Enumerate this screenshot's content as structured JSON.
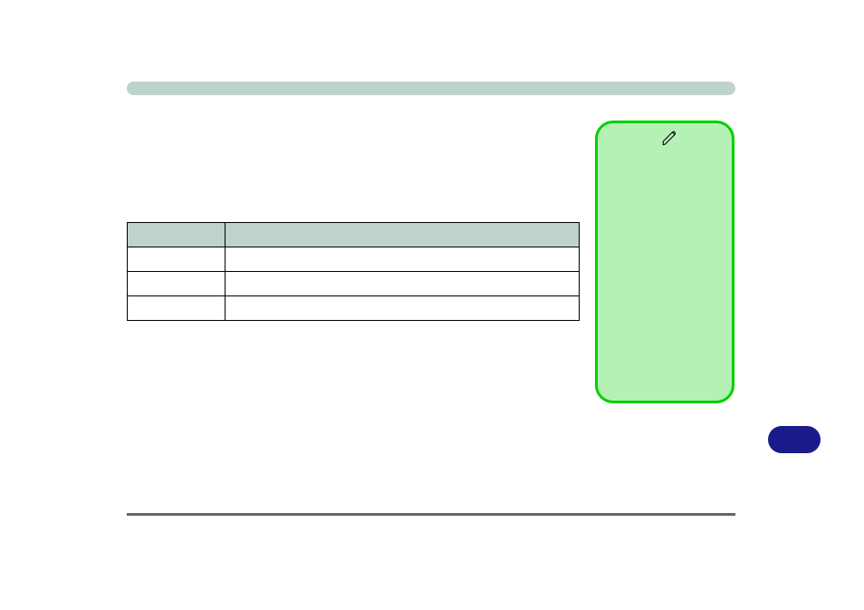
{
  "header": {
    "title": ""
  },
  "table": {
    "headers": [
      "",
      ""
    ],
    "rows": [
      [
        "",
        ""
      ],
      [
        "",
        ""
      ],
      [
        "",
        ""
      ]
    ]
  },
  "side_box": {
    "icon": "pen-icon",
    "content": ""
  },
  "pill_button": {
    "label": ""
  },
  "colors": {
    "header_bar": "#bfd3ce",
    "side_box_fill": "#b5f0b5",
    "side_box_border": "#00d000",
    "pill_button": "#1a1a8a"
  }
}
